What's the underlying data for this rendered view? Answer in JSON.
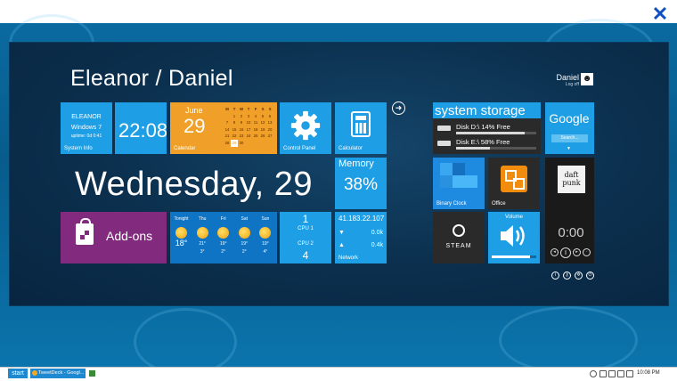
{
  "window": {
    "close_glyph": "✕"
  },
  "header": {
    "title": "Eleanor / Daniel",
    "user_name": "Daniel",
    "user_sub": "Log off",
    "arrow_glyph": "➜"
  },
  "sysinfo": {
    "name": "ELEANOR",
    "os": "Windows 7",
    "uptime": "uptime: 0d 0:41",
    "label": "System Info"
  },
  "clock": {
    "time": "22:08"
  },
  "calendar": {
    "month": "June",
    "day": "29",
    "label": "Calendar",
    "weekdays": [
      "M",
      "T",
      "W",
      "T",
      "F",
      "S",
      "S"
    ],
    "days": [
      "",
      "1",
      "2",
      "3",
      "4",
      "5",
      "6",
      "7",
      "8",
      "9",
      "10",
      "11",
      "12",
      "13",
      "14",
      "15",
      "16",
      "17",
      "18",
      "19",
      "20",
      "21",
      "22",
      "23",
      "24",
      "25",
      "26",
      "27",
      "28",
      "29",
      "30",
      "",
      "",
      "",
      "",
      ""
    ]
  },
  "control_panel": {
    "label": "Control Panel"
  },
  "calculator": {
    "label": "Calculator"
  },
  "date_big": "Wednesday, 29",
  "memory": {
    "label": "Memory",
    "value": "38%"
  },
  "addons": {
    "label": "Add-ons"
  },
  "weather": {
    "days": [
      {
        "day": "Tonight",
        "temp": "18°",
        "low": ""
      },
      {
        "day": "Thu",
        "temp": "21°",
        "low": "3°"
      },
      {
        "day": "Fri",
        "temp": "19°",
        "low": "2°"
      },
      {
        "day": "Sat",
        "temp": "19°",
        "low": "2°"
      },
      {
        "day": "Sun",
        "temp": "19°",
        "low": "4°"
      }
    ]
  },
  "cpu": {
    "cpu1_value": "1",
    "cpu1_label": "CPU 1",
    "cpu2_label": "CPU 2",
    "cpu2_value": "4"
  },
  "network": {
    "ip": "41.183.22.107",
    "down": "0.0k",
    "up": "0.4k",
    "label": "Network"
  },
  "storage": {
    "title": "system storage",
    "disks": [
      {
        "label": "Disk D:\\ 14% Free",
        "free_fraction": 0.14
      },
      {
        "label": "Disk E:\\ 58% Free",
        "free_fraction": 0.58
      }
    ]
  },
  "google": {
    "word": "Google",
    "search": "Search..."
  },
  "binary_clock": {
    "label": "Binary Clock"
  },
  "office": {
    "label": "Office"
  },
  "steam": {
    "label": "STEAM"
  },
  "volume": {
    "label": "Volume",
    "level": 0.85
  },
  "music": {
    "cover_text": "daft punk",
    "time": "0:00"
  },
  "taskbar": {
    "start": "start",
    "task": "TweetDeck - Googl...",
    "time": "10:08 PM"
  },
  "colors": {
    "accent_blue": "#1e9ee4",
    "calendar_orange": "#f0a028",
    "addons_purple": "#812a7e",
    "office_orange": "#f28c0f"
  }
}
